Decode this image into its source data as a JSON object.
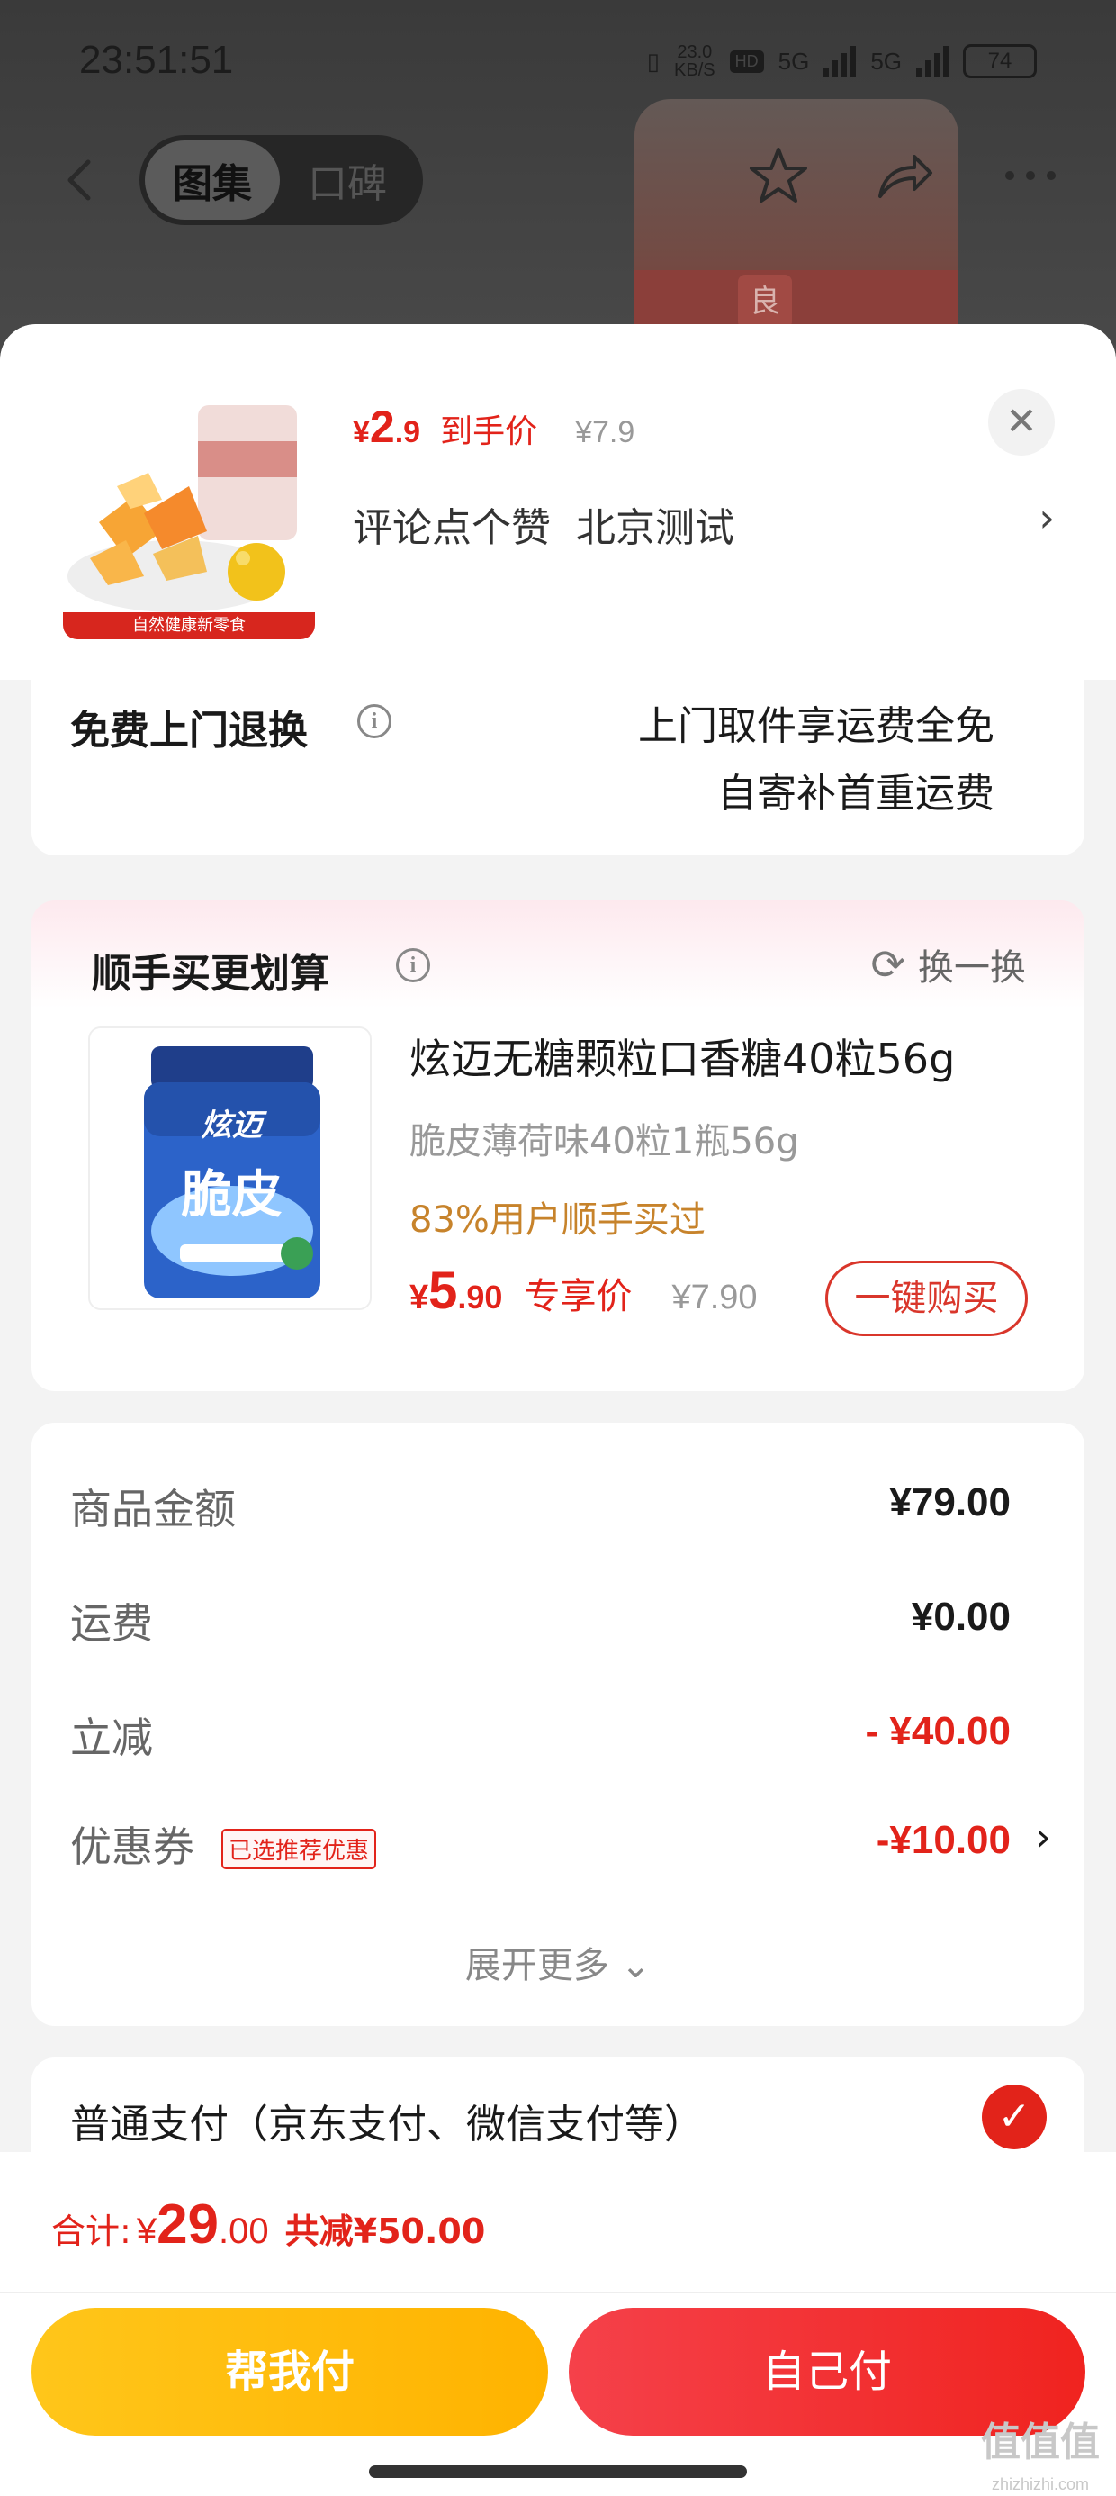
{
  "status_bar": {
    "time": "23:51:51",
    "net_speed_value": "23.0",
    "net_speed_unit": "KB/S",
    "hd_badge": "HD",
    "network_1": "5G",
    "network_2": "5G",
    "battery": "74"
  },
  "nav": {
    "tabs": [
      {
        "label": "图集",
        "active": true
      },
      {
        "label": "口碑",
        "active": false
      }
    ]
  },
  "product": {
    "currency": "¥",
    "price_int": "2",
    "price_dec": ".9",
    "price_tag": "到手价",
    "original_price": "¥7.9",
    "variant": "评论点个赞  北京测试",
    "image_caption": "自然健康新零食"
  },
  "return_service": {
    "title": "免费上门退换",
    "line1": "上门取件享运费全免",
    "line2": "自寄补首重运费"
  },
  "bundle": {
    "title": "顺手买更划算",
    "swap_label": "换一换",
    "product_name": "炫迈无糖颗粒口香糖40粒56g",
    "spec": "脆皮薄荷味40粒1瓶56g",
    "stat": "83%用户顺手买过",
    "currency": "¥",
    "price_int": "5",
    "price_dec": ".90",
    "price_tag": "专享价",
    "original_price": "¥7.90",
    "buy_label": "一键购买",
    "image_brand": "炫迈",
    "image_title": "脆皮"
  },
  "summary": {
    "rows": [
      {
        "label": "商品金额",
        "value": "¥79.00"
      },
      {
        "label": "运费",
        "value": "¥0.00"
      },
      {
        "label": "立减",
        "value": "- ¥40.00"
      },
      {
        "label": "优惠券",
        "value": "-¥10.00",
        "badge": "已选推荐优惠"
      }
    ],
    "expand_label": "展开更多"
  },
  "payment": {
    "method": "普通支付（京东支付、微信支付等）"
  },
  "footer": {
    "total_label": "合计:",
    "currency": "¥",
    "total_int": "29",
    "total_dec": ".00",
    "total_save": "共减¥50.00",
    "help_pay_label": "帮我付",
    "self_pay_label": "自己付"
  },
  "watermark": {
    "text": "值值值",
    "url": "zhizhizhi.com"
  },
  "colors": {
    "accent_red": "#e2231a",
    "help_button": "#ffb300",
    "self_button": "#f0231f",
    "stat_orange": "#c7832b"
  }
}
